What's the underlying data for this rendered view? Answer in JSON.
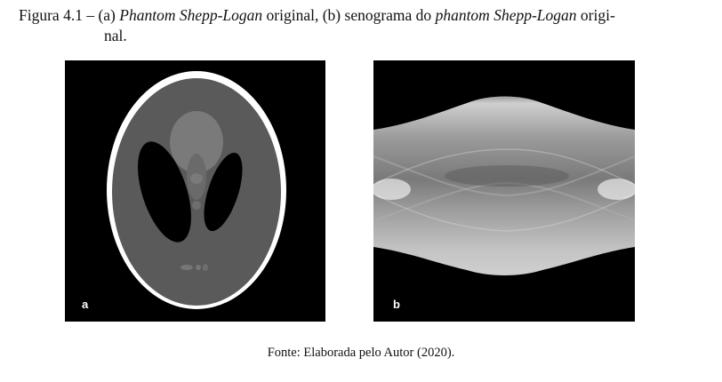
{
  "caption": {
    "label": "Figura 4.1",
    "separator": " – ",
    "part_a_prefix": "(a) ",
    "part_a_emph": "Phantom Shepp-Logan",
    "part_a_suffix": " original, (b) senograma do ",
    "part_b_emph": "phantom Shepp-Logan",
    "part_b_suffix": " origi-",
    "line2": "nal."
  },
  "panels": [
    {
      "letter": "a"
    },
    {
      "letter": "b"
    }
  ],
  "source": "Fonte: Elaborada pelo Autor (2020)."
}
